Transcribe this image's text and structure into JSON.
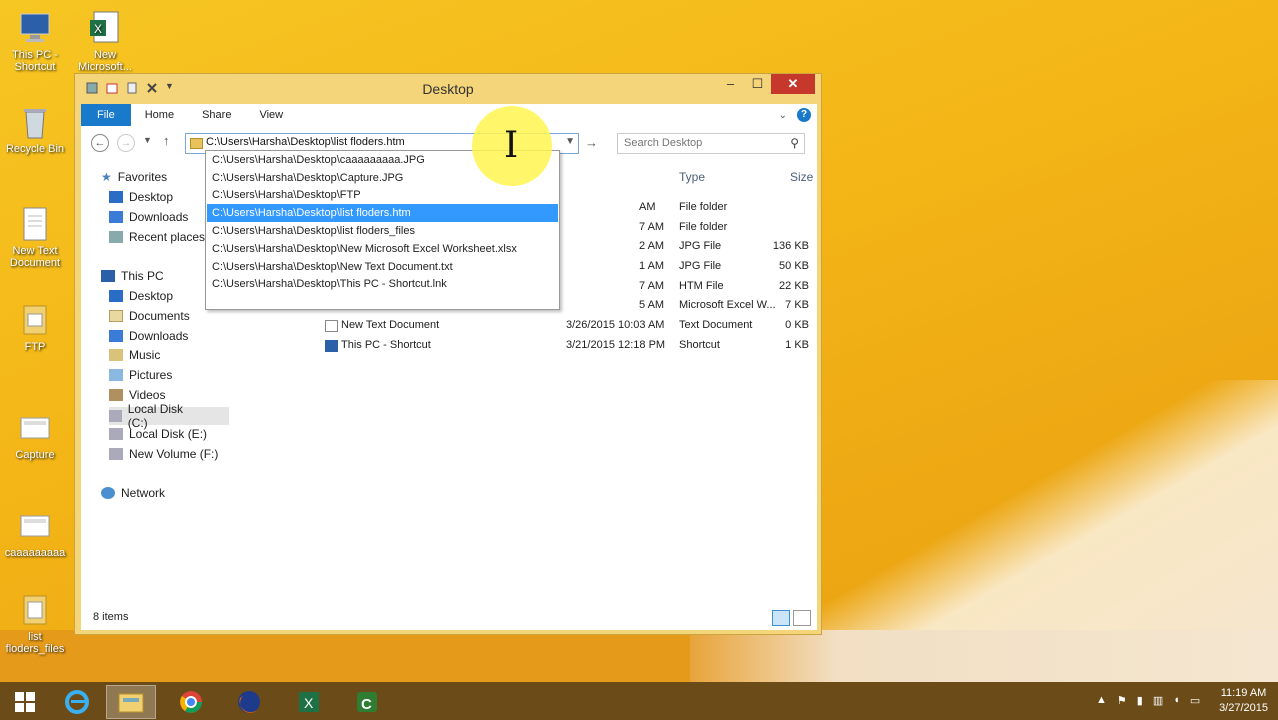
{
  "desktop_icons": [
    {
      "label": "This PC - Shortcut",
      "icon": "computer-icon"
    },
    {
      "label": "New Microsoft...",
      "icon": "excel-icon"
    },
    {
      "label": "Recycle Bin",
      "icon": "recycle-bin-icon"
    },
    {
      "label": "New Text Document",
      "icon": "text-document-icon"
    },
    {
      "label": "FTP",
      "icon": "folder-icon"
    },
    {
      "label": "Capture",
      "icon": "image-icon"
    },
    {
      "label": "caaaaaaaaa",
      "icon": "image-icon"
    },
    {
      "label": "list floders_files",
      "icon": "folder-icon"
    }
  ],
  "window": {
    "title": "Desktop",
    "ribbon_tabs": [
      "File",
      "Home",
      "Share",
      "View"
    ],
    "address": "C:\\Users\\Harsha\\Desktop\\list floders.htm",
    "search_placeholder": "Search Desktop",
    "columns": {
      "type": "Type",
      "size": "Size"
    },
    "status": "8 items"
  },
  "nav_pane": {
    "favorites": {
      "label": "Favorites",
      "items": [
        "Desktop",
        "Downloads",
        "Recent places"
      ]
    },
    "this_pc": {
      "label": "This PC",
      "items": [
        "Desktop",
        "Documents",
        "Downloads",
        "Music",
        "Pictures",
        "Videos",
        "Local Disk (C:)",
        "Local Disk (E:)",
        "New Volume (F:)"
      ]
    },
    "network": {
      "label": "Network"
    }
  },
  "files": [
    {
      "name": "",
      "date": "AM",
      "type": "File folder",
      "size": ""
    },
    {
      "name": "",
      "date": "7 AM",
      "type": "File folder",
      "size": ""
    },
    {
      "name": "",
      "date": "2 AM",
      "type": "JPG File",
      "size": "136 KB"
    },
    {
      "name": "",
      "date": "1 AM",
      "type": "JPG File",
      "size": "50 KB"
    },
    {
      "name": "",
      "date": "7 AM",
      "type": "HTM File",
      "size": "22 KB"
    },
    {
      "name": "",
      "date": "5 AM",
      "type": "Microsoft Excel W...",
      "size": "7 KB"
    },
    {
      "name": "New Text Document",
      "date": "3/26/2015 10:03 AM",
      "type": "Text Document",
      "size": "0 KB"
    },
    {
      "name": "This PC - Shortcut",
      "date": "3/21/2015 12:18 PM",
      "type": "Shortcut",
      "size": "1 KB"
    }
  ],
  "autocomplete": [
    "C:\\Users\\Harsha\\Desktop\\caaaaaaaaa.JPG",
    "C:\\Users\\Harsha\\Desktop\\Capture.JPG",
    "C:\\Users\\Harsha\\Desktop\\FTP",
    "C:\\Users\\Harsha\\Desktop\\list floders.htm",
    "C:\\Users\\Harsha\\Desktop\\list floders_files",
    "C:\\Users\\Harsha\\Desktop\\New Microsoft Excel Worksheet.xlsx",
    "C:\\Users\\Harsha\\Desktop\\New Text Document.txt",
    "C:\\Users\\Harsha\\Desktop\\This PC - Shortcut.lnk"
  ],
  "autocomplete_highlighted": 3,
  "taskbar": {
    "apps": [
      "start-icon",
      "internet-explorer-icon",
      "file-explorer-icon",
      "chrome-icon",
      "firefox-icon",
      "excel-icon",
      "camtasia-icon"
    ],
    "time": "11:19 AM",
    "date": "3/27/2015"
  },
  "colors": {
    "accent": "#1979ca",
    "highlight": "#3399ff",
    "window_frame": "#f5d57a",
    "close": "#c7382c"
  }
}
